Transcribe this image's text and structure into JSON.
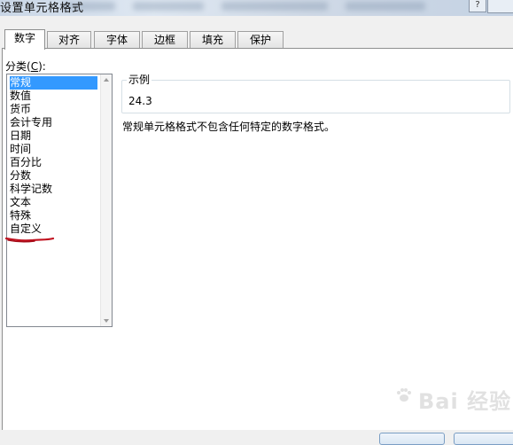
{
  "window": {
    "title": "设置单元格格式",
    "help_label": "?"
  },
  "tabs": [
    {
      "label": "数字",
      "active": true
    },
    {
      "label": "对齐",
      "active": false
    },
    {
      "label": "字体",
      "active": false
    },
    {
      "label": "边框",
      "active": false
    },
    {
      "label": "填充",
      "active": false
    },
    {
      "label": "保护",
      "active": false
    }
  ],
  "category": {
    "label_main": "分类(",
    "label_key": "C",
    "label_end": "):",
    "items": [
      "常规",
      "数值",
      "货币",
      "会计专用",
      "日期",
      "时间",
      "百分比",
      "分数",
      "科学记数",
      "文本",
      "特殊",
      "自定义"
    ],
    "selected": "常规"
  },
  "sample": {
    "title": "示例",
    "value": "24.3"
  },
  "description": "常规单元格格式不包含任何特定的数字格式。",
  "watermark": "Bai 经验",
  "colors": {
    "selection": "#3399ff",
    "annotation": "#c0101e"
  }
}
